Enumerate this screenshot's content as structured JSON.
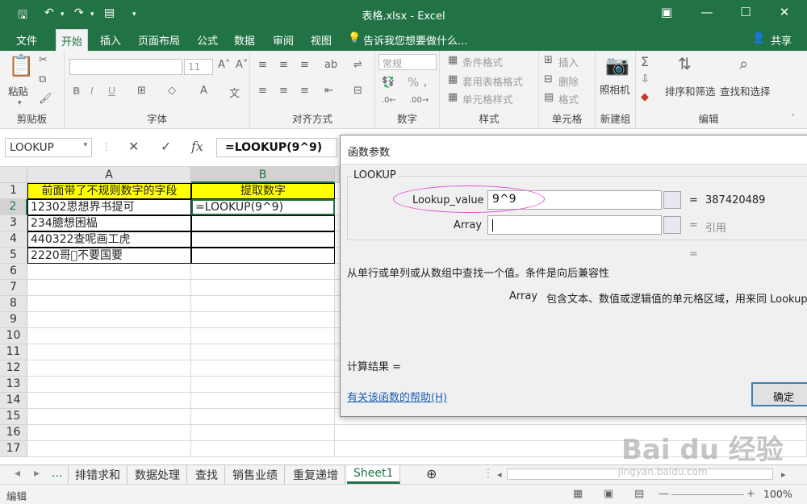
{
  "window": {
    "title": "表格.xlsx - Excel"
  },
  "menu": {
    "file": "文件",
    "tabs": [
      "开始",
      "插入",
      "页面布局",
      "公式",
      "数据",
      "审阅",
      "视图"
    ],
    "tell": "告诉我您想要做什么...",
    "share": "共享"
  },
  "ribbon": {
    "clipboard": {
      "paste": "粘贴",
      "label": "剪贴板"
    },
    "font": {
      "size": "11",
      "label": "字体",
      "bold": "B",
      "italic": "I",
      "underline": "U"
    },
    "align": {
      "label": "对齐方式"
    },
    "number": {
      "format": "常规",
      "label": "数字",
      "percent": "%"
    },
    "styles": {
      "cond": "条件格式",
      "table": "套用表格格式",
      "cell": "单元格样式",
      "label": "样式"
    },
    "cells": {
      "insert": "插入",
      "delete": "删除",
      "format": "格式",
      "label": "单元格"
    },
    "newgroup": {
      "camera": "照相机",
      "label": "新建组"
    },
    "edit": {
      "sort": "排序和筛选",
      "find": "查找和选择",
      "label": "编辑"
    }
  },
  "formula_bar": {
    "namebox": "LOOKUP",
    "fx": "fx",
    "content": "=LOOKUP(9^9)"
  },
  "sheet": {
    "columns": [
      "A",
      "B"
    ],
    "rows": [
      "1",
      "2",
      "3",
      "4",
      "5",
      "6",
      "7",
      "8",
      "9",
      "10",
      "11",
      "12",
      "13",
      "14",
      "15",
      "16",
      "17"
    ],
    "cells": [
      [
        "前面带了不规则数字的字段",
        "提取数字"
      ],
      [
        "12302思想界书提可",
        "=LOOKUP(9^9)"
      ],
      [
        "234臆想困榀",
        ""
      ],
      [
        "440322查呢画工虎",
        ""
      ],
      [
        "2220哥𫗭不要国要",
        ""
      ]
    ]
  },
  "sheet_tabs": {
    "more": "...",
    "tabs": [
      "排错求和",
      "数据处理",
      "查找",
      "销售业绩",
      "重复递增",
      "Sheet1"
    ],
    "active": "Sheet1"
  },
  "status": {
    "mode": "编辑",
    "zoom": "100%"
  },
  "dialog": {
    "title": "函数参数",
    "function": "LOOKUP",
    "args": [
      {
        "label": "Lookup_value",
        "value": "9^9",
        "result": "387420489"
      },
      {
        "label": "Array",
        "value": "",
        "result": "引用"
      }
    ],
    "eq": "=",
    "description": "从单行或单列或从数组中查找一个值。条件是向后兼容性",
    "arg_name": "Array",
    "arg_desc": "包含文本、数值或逻辑值的单元格区域，用来同 Lookup_",
    "calc_result": "计算结果 =",
    "help_link": "有关该函数的帮助(H)",
    "ok": "确定"
  },
  "watermark": {
    "brand": "Bai du 经验",
    "url": "jingyan.baidu.com"
  }
}
